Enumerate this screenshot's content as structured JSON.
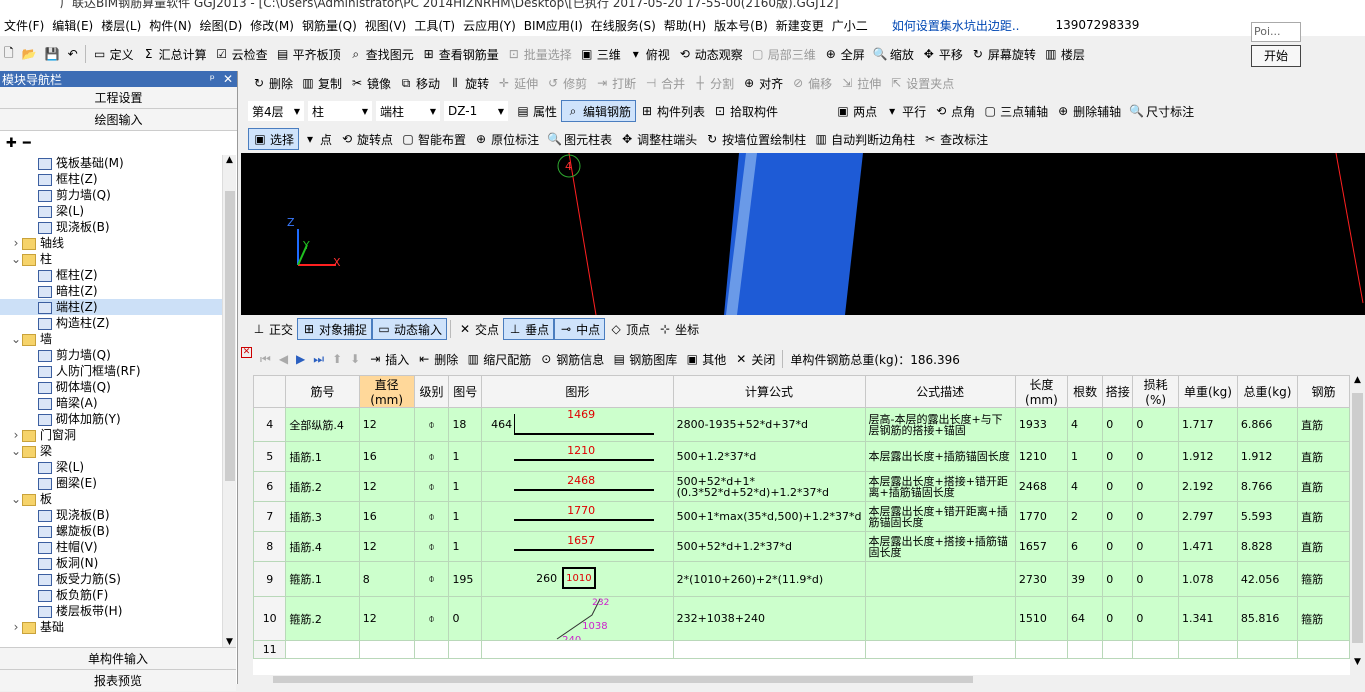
{
  "title": "广联达BIM钢筋算量软件 GGJ2013 - [C:\\Users\\Administrator\\PC 2014HIZNRHM\\Desktop\\[已执行 2017-05-20 17-55-00(2160版).GGJ12]",
  "menu": [
    "文件(F)",
    "编辑(E)",
    "楼层(L)",
    "构件(N)",
    "绘图(D)",
    "修改(M)",
    "钢筋量(Q)",
    "视图(V)",
    "工具(T)",
    "云应用(Y)",
    "BIM应用(I)",
    "在线服务(S)",
    "帮助(H)",
    "版本号(B)",
    "新建变更",
    "广小二"
  ],
  "menu_link": "如何设置集水坑出边距..",
  "menu_phone": "13907298339",
  "popup": {
    "text": "Poi...",
    "button": "开始"
  },
  "toolbar1": [
    "定义",
    "汇总计算",
    "云检查",
    "平齐板顶",
    "查找图元",
    "查看钢筋量",
    "批量选择",
    "三维",
    "俯视",
    "动态观察",
    "局部三维",
    "全屏",
    "缩放",
    "平移",
    "屏幕旋转",
    "楼层"
  ],
  "toolbar2": [
    "删除",
    "复制",
    "镜像",
    "移动",
    "旋转",
    "延伸",
    "修剪",
    "打断",
    "合并",
    "分割",
    "对齐",
    "偏移",
    "拉伸",
    "设置夹点"
  ],
  "toolbar3": {
    "floor": "第4层",
    "type": "柱",
    "sub": "端柱",
    "name": "DZ-1",
    "buttons": [
      "属性",
      "编辑钢筋",
      "构件列表",
      "拾取构件",
      "两点",
      "平行",
      "点角",
      "三点辅轴",
      "删除辅轴",
      "尺寸标注"
    ]
  },
  "toolbar4": [
    "选择",
    "点",
    "旋转点",
    "智能布置",
    "原位标注",
    "图元柱表",
    "调整柱端头",
    "按墙位置绘制柱",
    "自动判断边角柱",
    "查改标注"
  ],
  "snapbar": [
    "正交",
    "对象捕捉",
    "动态输入",
    "交点",
    "垂点",
    "中点",
    "顶点",
    "坐标"
  ],
  "gridbar": {
    "buttons": [
      "插入",
      "删除",
      "缩尺配筋",
      "钢筋信息",
      "钢筋图库",
      "其他",
      "关闭"
    ],
    "total_label": "单构件钢筋总重(kg)：186.396"
  },
  "nav": {
    "header": "模块导航栏",
    "pin": "ᵖ",
    "close": "✕",
    "sections": [
      "工程设置",
      "绘图输入"
    ],
    "footer": [
      "单构件输入",
      "报表预览"
    ]
  },
  "tree": [
    {
      "level": 2,
      "label": "筏板基础(M)",
      "type": "leaf"
    },
    {
      "level": 2,
      "label": "框柱(Z)",
      "type": "leaf"
    },
    {
      "level": 2,
      "label": "剪力墙(Q)",
      "type": "leaf"
    },
    {
      "level": 2,
      "label": "梁(L)",
      "type": "leaf"
    },
    {
      "level": 2,
      "label": "现浇板(B)",
      "type": "leaf"
    },
    {
      "level": 1,
      "label": "轴线",
      "type": "folder",
      "exp": "›"
    },
    {
      "level": 1,
      "label": "柱",
      "type": "folder",
      "exp": "⌄"
    },
    {
      "level": 2,
      "label": "框柱(Z)",
      "type": "leaf"
    },
    {
      "level": 2,
      "label": "暗柱(Z)",
      "type": "leaf"
    },
    {
      "level": 2,
      "label": "端柱(Z)",
      "type": "leaf",
      "selected": true
    },
    {
      "level": 2,
      "label": "构造柱(Z)",
      "type": "leaf"
    },
    {
      "level": 1,
      "label": "墙",
      "type": "folder",
      "exp": "⌄"
    },
    {
      "level": 2,
      "label": "剪力墙(Q)",
      "type": "leaf"
    },
    {
      "level": 2,
      "label": "人防门框墙(RF)",
      "type": "leaf"
    },
    {
      "level": 2,
      "label": "砌体墙(Q)",
      "type": "leaf"
    },
    {
      "level": 2,
      "label": "暗梁(A)",
      "type": "leaf"
    },
    {
      "level": 2,
      "label": "砌体加筋(Y)",
      "type": "leaf"
    },
    {
      "level": 1,
      "label": "门窗洞",
      "type": "folder",
      "exp": "›"
    },
    {
      "level": 1,
      "label": "梁",
      "type": "folder",
      "exp": "⌄"
    },
    {
      "level": 2,
      "label": "梁(L)",
      "type": "leaf"
    },
    {
      "level": 2,
      "label": "圈梁(E)",
      "type": "leaf"
    },
    {
      "level": 1,
      "label": "板",
      "type": "folder",
      "exp": "⌄"
    },
    {
      "level": 2,
      "label": "现浇板(B)",
      "type": "leaf"
    },
    {
      "level": 2,
      "label": "螺旋板(B)",
      "type": "leaf"
    },
    {
      "level": 2,
      "label": "柱帽(V)",
      "type": "leaf"
    },
    {
      "level": 2,
      "label": "板洞(N)",
      "type": "leaf"
    },
    {
      "level": 2,
      "label": "板受力筋(S)",
      "type": "leaf"
    },
    {
      "level": 2,
      "label": "板负筋(F)",
      "type": "leaf"
    },
    {
      "level": 2,
      "label": "楼层板带(H)",
      "type": "leaf"
    },
    {
      "level": 1,
      "label": "基础",
      "type": "folder",
      "exp": "›"
    }
  ],
  "viewport": {
    "axis_label": "4",
    "axis_z": "Z",
    "axis_y": "Y",
    "axis_x": "X"
  },
  "columns": [
    "",
    "筋号",
    "直径(mm)",
    "级别",
    "图号",
    "图形",
    "计算公式",
    "公式描述",
    "长度(mm)",
    "根数",
    "搭接",
    "损耗(%)",
    "单重(kg)",
    "总重(kg)",
    "钢筋"
  ],
  "rows": [
    {
      "no": "4",
      "name": "全部纵筋.4",
      "dia": "12",
      "grade": "⌽",
      "fig": "18",
      "shape_left": "464",
      "shape_mid": "1469",
      "formula": "2800-1935+52*d+37*d",
      "desc": "层高-本层的露出长度+与下层钢筋的搭接+锚固",
      "len": "1933",
      "count": "4",
      "lap": "0",
      "loss": "0",
      "unit": "1.717",
      "total": "6.866",
      "type": "直筋"
    },
    {
      "no": "5",
      "name": "插筋.1",
      "dia": "16",
      "grade": "⌽",
      "fig": "1",
      "shape_mid": "1210",
      "formula": "500+1.2*37*d",
      "desc": "本层露出长度+插筋锚固长度",
      "len": "1210",
      "count": "1",
      "lap": "0",
      "loss": "0",
      "unit": "1.912",
      "total": "1.912",
      "type": "直筋"
    },
    {
      "no": "6",
      "name": "插筋.2",
      "dia": "12",
      "grade": "⌽",
      "fig": "1",
      "shape_mid": "2468",
      "formula": "500+52*d+1*(0.3*52*d+52*d)+1.2*37*d",
      "desc": "本层露出长度+搭接+错开距离+插筋锚固长度",
      "len": "2468",
      "count": "4",
      "lap": "0",
      "loss": "0",
      "unit": "2.192",
      "total": "8.766",
      "type": "直筋"
    },
    {
      "no": "7",
      "name": "插筋.3",
      "dia": "16",
      "grade": "⌽",
      "fig": "1",
      "shape_mid": "1770",
      "formula": "500+1*max(35*d,500)+1.2*37*d",
      "desc": "本层露出长度+错开距离+插筋锚固长度",
      "len": "1770",
      "count": "2",
      "lap": "0",
      "loss": "0",
      "unit": "2.797",
      "total": "5.593",
      "type": "直筋"
    },
    {
      "no": "8",
      "name": "插筋.4",
      "dia": "12",
      "grade": "⌽",
      "fig": "1",
      "shape_mid": "1657",
      "formula": "500+52*d+1.2*37*d",
      "desc": "本层露出长度+搭接+插筋锚固长度",
      "len": "1657",
      "count": "6",
      "lap": "0",
      "loss": "0",
      "unit": "1.471",
      "total": "8.828",
      "type": "直筋"
    },
    {
      "no": "9",
      "name": "箍筋.1",
      "dia": "8",
      "grade": "⌽",
      "fig": "195",
      "shape_left": "260",
      "shape_mid": "1010",
      "formula": "2*(1010+260)+2*(11.9*d)",
      "desc": "",
      "len": "2730",
      "count": "39",
      "lap": "0",
      "loss": "0",
      "unit": "1.078",
      "total": "42.056",
      "type": "箍筋"
    },
    {
      "no": "10",
      "name": "箍筋.2",
      "dia": "12",
      "grade": "⌽",
      "fig": "0",
      "shape_a": "232",
      "shape_mid": "1038",
      "shape_left": "240",
      "formula": "232+1038+240",
      "desc": "",
      "len": "1510",
      "count": "64",
      "lap": "0",
      "loss": "0",
      "unit": "1.341",
      "total": "85.816",
      "type": "箍筋"
    },
    {
      "no": "11",
      "name": "",
      "dia": "",
      "grade": "",
      "fig": "",
      "formula": "",
      "desc": "",
      "len": "",
      "count": "",
      "lap": "",
      "loss": "",
      "unit": "",
      "total": "",
      "type": ""
    }
  ],
  "colors": {
    "row_bg": "#ccffcc",
    "nav_header": "#3d6db5",
    "viewport": "#000000",
    "blue_wall": "#1e5bd6",
    "red_line": "#ff2020",
    "shape_text": "#e00000",
    "stirrup_text": "#cc22cc"
  }
}
